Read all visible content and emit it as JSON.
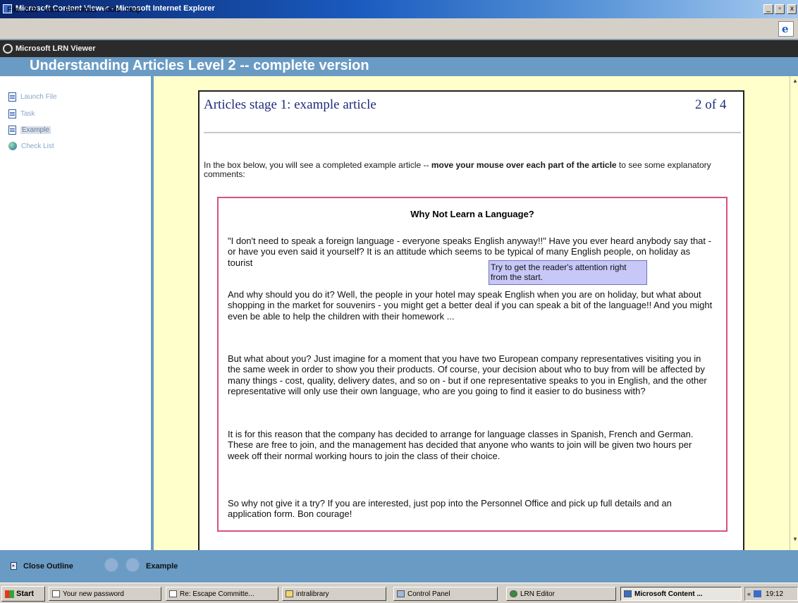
{
  "window": {
    "title": "Microsoft Content Viewer - Microsoft Internet Explorer",
    "minimize": "_",
    "maximize": "▫",
    "close": "x"
  },
  "menu": [
    "File",
    "Edit",
    "View",
    "Favorites",
    "Tools",
    "Help"
  ],
  "viewer": {
    "name": "Microsoft LRN Viewer"
  },
  "course": {
    "title": "Understanding Articles Level 2 -- complete version"
  },
  "sidebar": {
    "items": [
      {
        "label": "Launch File",
        "icon": "page-icon",
        "selected": false
      },
      {
        "label": "Task",
        "icon": "page-icon",
        "selected": false
      },
      {
        "label": "Example",
        "icon": "page-icon",
        "selected": true
      },
      {
        "label": "Check List",
        "icon": "globe-icon",
        "selected": false
      }
    ]
  },
  "content": {
    "heading": "Articles stage 1: example article",
    "page_indicator": "2 of 4",
    "intro_plain": "In the box below, you will see a completed example article -- ",
    "intro_bold": "move your mouse over each part of the article",
    "intro_end": " to see some explanatory comments:",
    "article": {
      "title": "Why Not Learn a Language?",
      "paragraphs": [
        "\"I don't need to speak a foreign language - everyone speaks English anyway!!\" Have you ever heard anybody say that - or have you even said it yourself? It is an attitude which seems to be typical of many English people, on holiday as tourist",
        "And why should you do it? Well, the people in your hotel may speak English when you are on holiday, but what about shopping in the market for souvenirs - you might get a better deal if you can speak a bit of the language!! And you might even be able to help the children with their homework ...",
        "But what about you? Just imagine for a moment that you have two European company representatives visiting you in the same week in order to show you their products. Of course, your decision about who to buy from will be affected by many things - cost, quality, delivery dates, and so on - but if one representative speaks to you in English, and the other representative will only use their own language, who are you going to find it easier to do business with?",
        "It is for this reason that the company has decided to arrange for language classes in Spanish, French and German. These are free to join, and the management has decided that anyone who wants to join will be given two hours per week off their normal working hours to join the class of their choice.",
        "So why not give it a try? If you are interested, just pop into the Personnel Office and pick up full details and an application form. Bon courage!"
      ],
      "tooltip": "Try to get the reader's attention right from the start."
    }
  },
  "outline": {
    "close_label": "Close Outline",
    "current": "Example"
  },
  "taskbar": {
    "start": "Start",
    "tasks": [
      "Your new password",
      "Re: Escape Committe...",
      "intralibrary",
      "Control Panel",
      "LRN Editor",
      "Microsoft Content ..."
    ],
    "clock": "19:12",
    "chevron": "«"
  }
}
